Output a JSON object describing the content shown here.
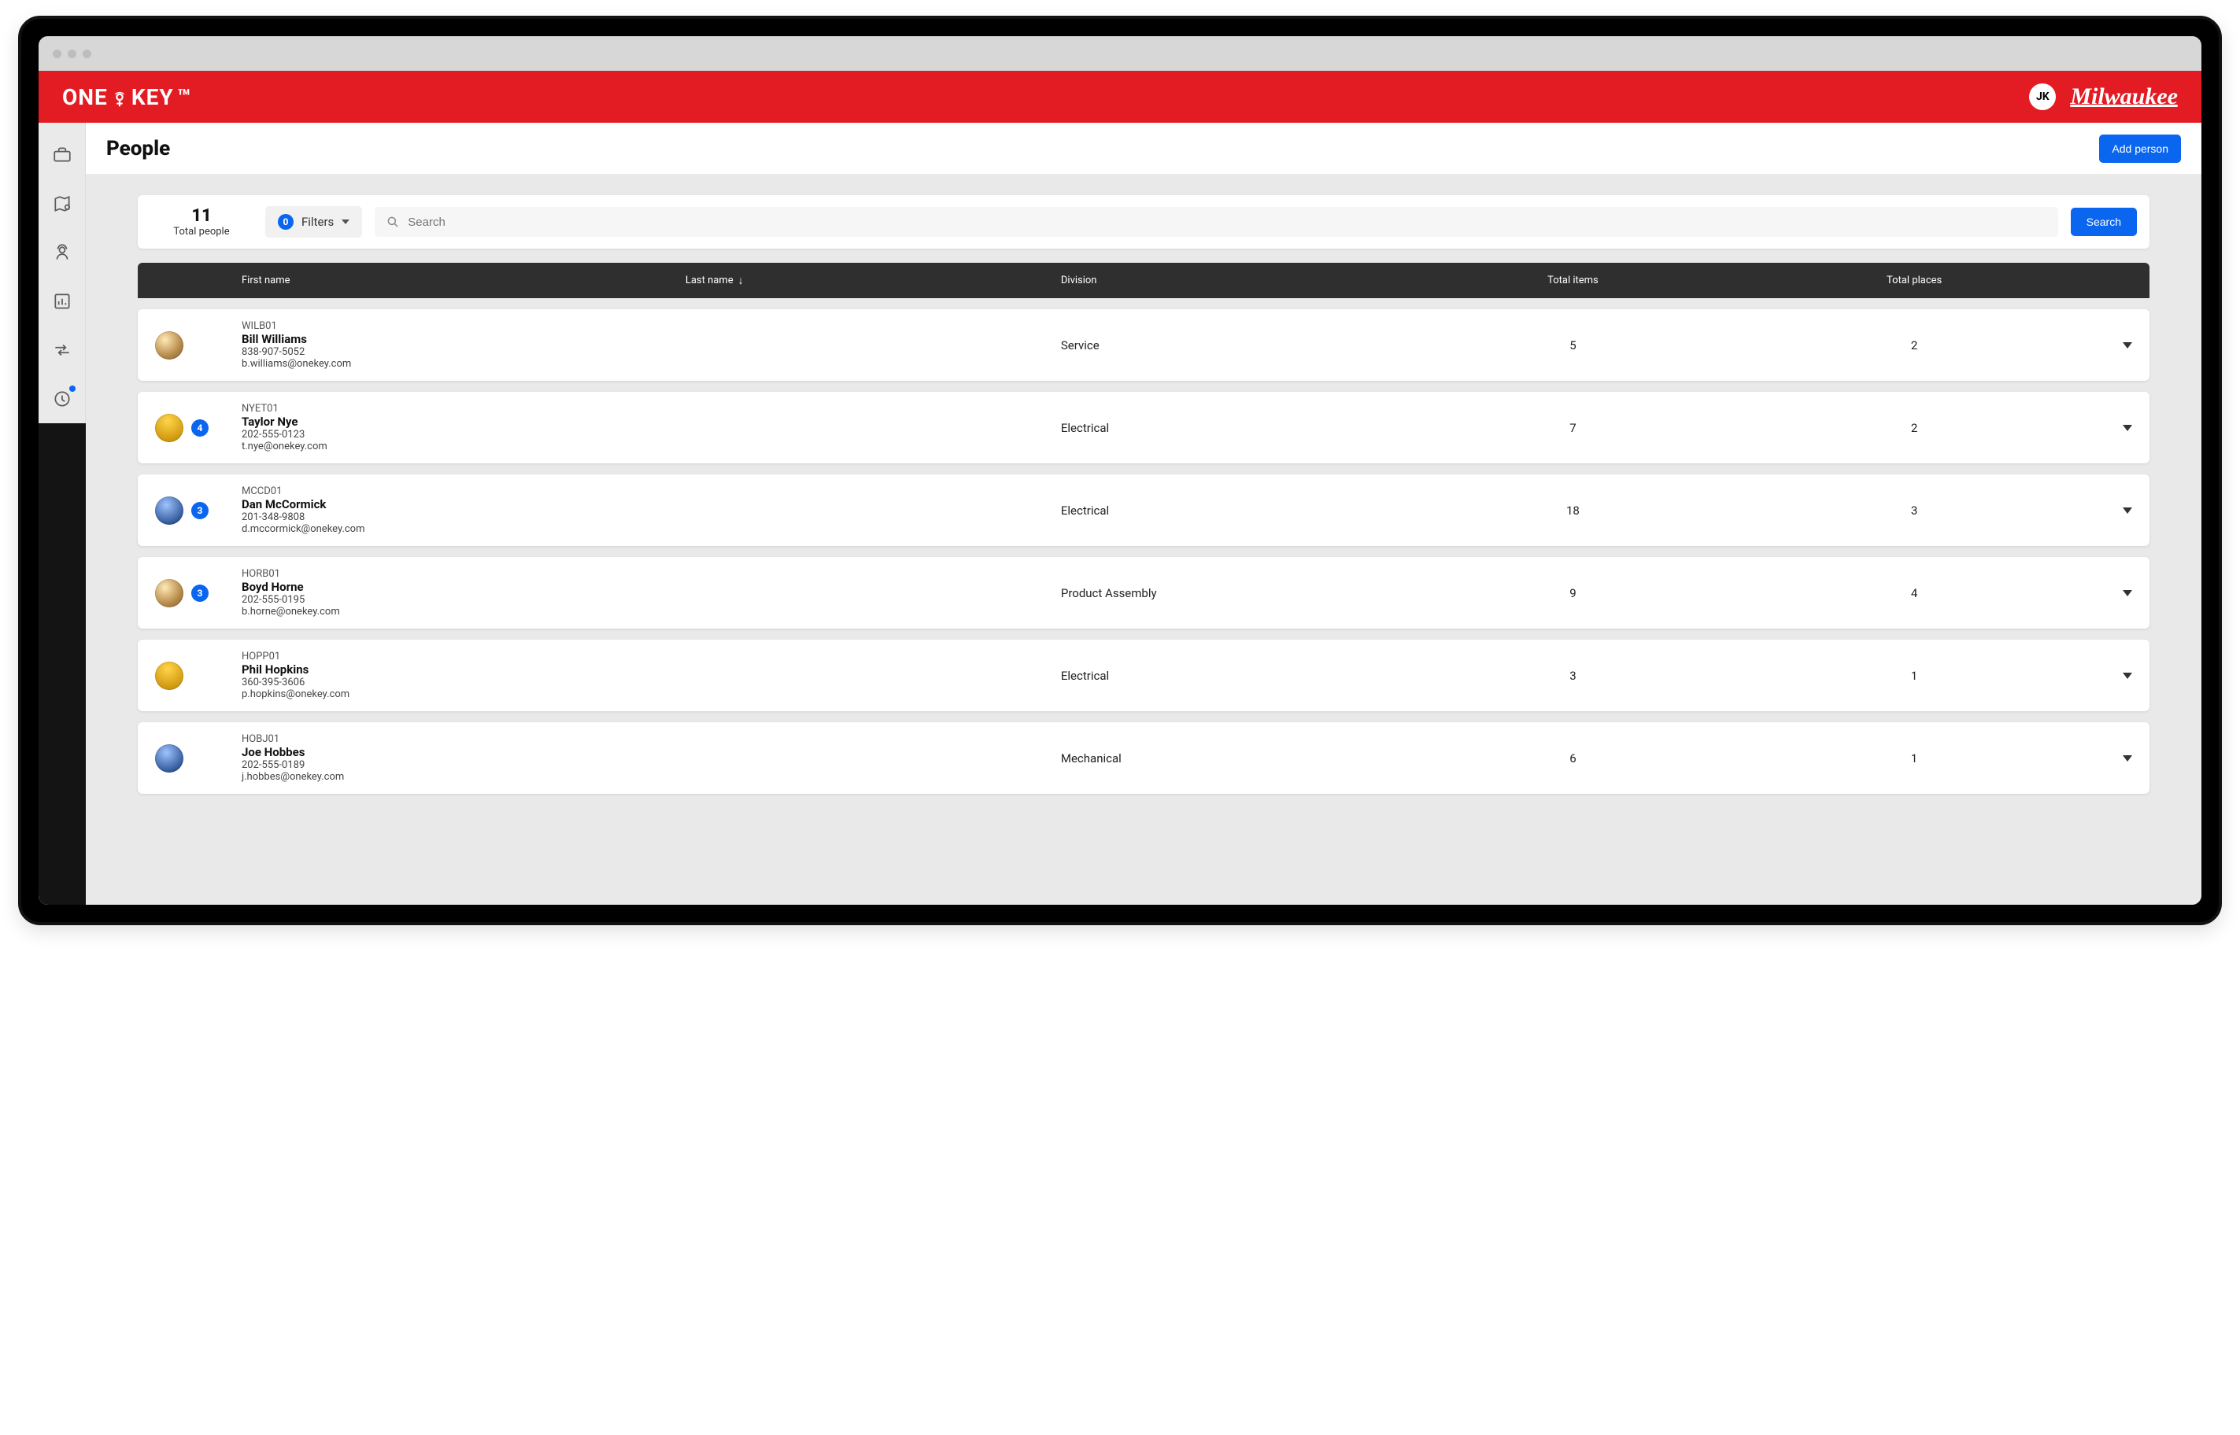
{
  "window": {
    "dots": 3
  },
  "brand": {
    "left_one": "ONE",
    "left_key": "KEY",
    "right_logo_text": "Milwaukee",
    "avatar_initials": "JK"
  },
  "page": {
    "title": "People",
    "add_button": "Add person"
  },
  "filters": {
    "total_number": "11",
    "total_label": "Total people",
    "filters_label": "Filters",
    "filters_count": "0",
    "search_placeholder": "Search",
    "search_button": "Search"
  },
  "columns": {
    "first_name": "First name",
    "last_name": "Last name",
    "division": "Division",
    "total_items": "Total items",
    "total_places": "Total places",
    "sort_indicator": "↓"
  },
  "rows": [
    {
      "avatar_style": "",
      "badge": "",
      "code": "WILB01",
      "name": "Bill Williams",
      "phone": "838-907-5052",
      "email": "b.williams@onekey.com",
      "division": "Service",
      "total_items": "5",
      "total_places": "2"
    },
    {
      "avatar_style": "helmet",
      "badge": "4",
      "code": "NYET01",
      "name": "Taylor Nye",
      "phone": "202-555-0123",
      "email": "t.nye@onekey.com",
      "division": "Electrical",
      "total_items": "7",
      "total_places": "2"
    },
    {
      "avatar_style": "blue",
      "badge": "3",
      "code": "MCCD01",
      "name": "Dan McCormick",
      "phone": "201-348-9808",
      "email": "d.mccormick@onekey.com",
      "division": "Electrical",
      "total_items": "18",
      "total_places": "3"
    },
    {
      "avatar_style": "",
      "badge": "3",
      "code": "HORB01",
      "name": "Boyd Horne",
      "phone": "202-555-0195",
      "email": "b.horne@onekey.com",
      "division": "Product Assembly",
      "total_items": "9",
      "total_places": "4"
    },
    {
      "avatar_style": "helmet",
      "badge": "",
      "code": "HOPP01",
      "name": "Phil Hopkins",
      "phone": "360-395-3606",
      "email": "p.hopkins@onekey.com",
      "division": "Electrical",
      "total_items": "3",
      "total_places": "1"
    },
    {
      "avatar_style": "blue",
      "badge": "",
      "code": "HOBJ01",
      "name": "Joe Hobbes",
      "phone": "202-555-0189",
      "email": "j.hobbes@onekey.com",
      "division": "Mechanical",
      "total_items": "6",
      "total_places": "1"
    }
  ]
}
